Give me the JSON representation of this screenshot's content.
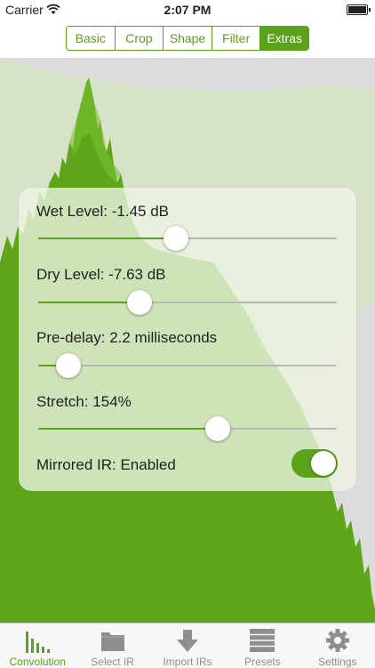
{
  "status_bar": {
    "carrier": "Carrier",
    "time": "2:07 PM"
  },
  "segments": [
    {
      "label": "Basic",
      "active": false
    },
    {
      "label": "Crop",
      "active": false
    },
    {
      "label": "Shape",
      "active": false
    },
    {
      "label": "Filter",
      "active": false
    },
    {
      "label": "Extras",
      "active": true
    }
  ],
  "controls": {
    "wet_level": {
      "label": "Wet Level: -1.45 dB",
      "fraction": 0.46
    },
    "dry_level": {
      "label": "Dry Level: -7.63 dB",
      "fraction": 0.34
    },
    "pre_delay": {
      "label": "Pre-delay: 2.2 milliseconds",
      "fraction": 0.1
    },
    "stretch": {
      "label": "Stretch: 154%",
      "fraction": 0.6
    },
    "mirrored_ir": {
      "label": "Mirrored IR: Enabled",
      "on": true
    }
  },
  "tab_bar": [
    {
      "label": "Convolution",
      "icon": "bar-chart-icon",
      "active": true
    },
    {
      "label": "Select IR",
      "icon": "folder-icon",
      "active": false
    },
    {
      "label": "Import IRs",
      "icon": "download-arrow-icon",
      "active": false
    },
    {
      "label": "Presets",
      "icon": "list-icon",
      "active": false
    },
    {
      "label": "Settings",
      "icon": "gear-icon",
      "active": false
    }
  ],
  "colors": {
    "accent": "#5aa21a",
    "wave_green": "#5ea51a",
    "wave_light": "#d6e2c8",
    "gray_bg": "#dadada"
  }
}
